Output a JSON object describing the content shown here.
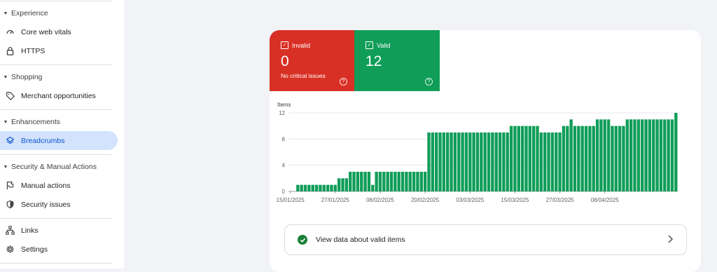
{
  "sidebar": {
    "sections": [
      {
        "header": "Experience",
        "items": [
          {
            "label": "Core web vitals",
            "icon": "gauge-icon"
          },
          {
            "label": "HTTPS",
            "icon": "lock-icon"
          }
        ]
      },
      {
        "header": "Shopping",
        "items": [
          {
            "label": "Merchant opportunities",
            "icon": "tag-icon"
          }
        ]
      },
      {
        "header": "Enhancements",
        "items": [
          {
            "label": "Breadcrumbs",
            "icon": "layers-icon",
            "active": true
          }
        ]
      },
      {
        "header": "Security & Manual Actions",
        "items": [
          {
            "label": "Manual actions",
            "icon": "flag-icon"
          },
          {
            "label": "Security issues",
            "icon": "shield-icon"
          }
        ]
      }
    ],
    "links_label": "Links",
    "settings_label": "Settings"
  },
  "tiles": {
    "invalid": {
      "label": "Invalid",
      "value": "0",
      "sub": "No critical issues",
      "color": "#d93025"
    },
    "valid": {
      "label": "Valid",
      "value": "12",
      "color": "#0f9d58"
    }
  },
  "chart_data": {
    "type": "bar",
    "ylabel": "Items",
    "ylim": [
      0,
      12
    ],
    "yticks": [
      0,
      4,
      8,
      12
    ],
    "xtick_labels": [
      "15/01/2025",
      "27/01/2025",
      "08/02/2025",
      "20/02/2025",
      "03/03/2025",
      "15/03/2025",
      "27/03/2025",
      "08/04/2025"
    ],
    "bar_color": "#0f9d58",
    "start_date": "2025-01-15",
    "values": [
      0,
      0,
      1,
      1,
      1,
      1,
      1,
      1,
      1,
      1,
      1,
      1,
      1,
      2,
      2,
      2,
      3,
      3,
      3,
      3,
      3,
      3,
      1,
      3,
      3,
      3,
      3,
      3,
      3,
      3,
      3,
      3,
      3,
      3,
      3,
      3,
      3,
      9,
      9,
      9,
      9,
      9,
      9,
      9,
      9,
      9,
      9,
      9,
      9,
      9,
      9,
      9,
      9,
      9,
      9,
      9,
      9,
      9,
      9,
      10,
      10,
      10,
      10,
      10,
      10,
      10,
      10,
      9,
      9,
      9,
      9,
      9,
      9,
      10,
      10,
      11,
      10,
      10,
      10,
      10,
      10,
      10,
      11,
      11,
      11,
      11,
      10,
      10,
      10,
      10,
      11,
      11,
      11,
      11,
      11,
      11,
      11,
      11,
      11,
      11,
      11,
      11,
      11,
      12
    ]
  },
  "valid_link": {
    "label": "View data about valid items"
  }
}
